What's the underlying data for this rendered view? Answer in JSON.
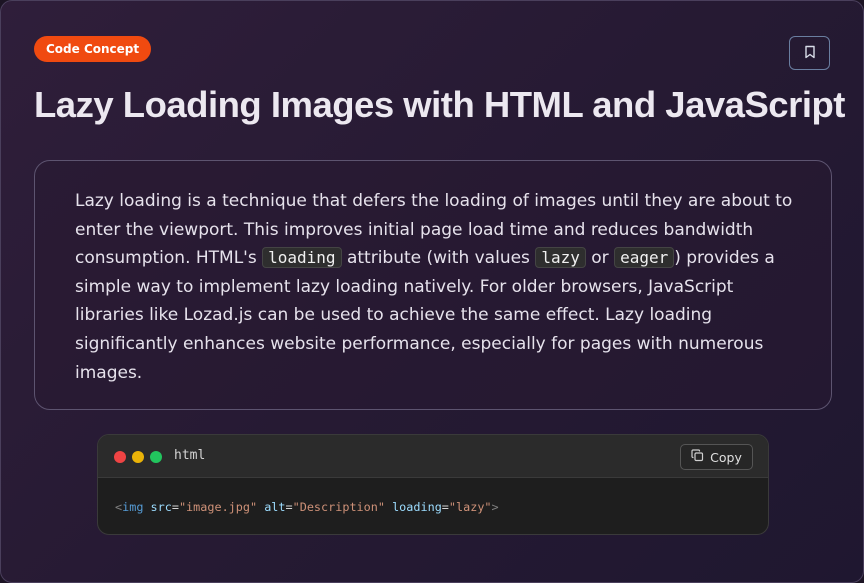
{
  "badge": {
    "label": "Code Concept",
    "color": "#f04a10"
  },
  "bookmark": {
    "icon": "bookmark-icon"
  },
  "title": "Lazy Loading Images with HTML and JavaScript",
  "description": {
    "part1": "Lazy loading is a technique that defers the loading of images until they are about to enter the viewport. This improves initial page load time and reduces bandwidth consumption. HTML's ",
    "code1": "loading",
    "part2": " attribute (with values ",
    "code2": "lazy",
    "part3": " or ",
    "code3": "eager",
    "part4": ") provides a simple way to implement lazy loading natively. For older browsers, JavaScript libraries like Lozad.js can be used to achieve the same effect. Lazy loading significantly enhances website performance, especially for pages with numerous images."
  },
  "code_block": {
    "language": "html",
    "copy_label": "Copy",
    "copy_icon": "copy-icon",
    "window_dots": [
      "#ef4444",
      "#eab308",
      "#22c55e"
    ],
    "code": {
      "open": "<",
      "tag": "img",
      "attr1": "src",
      "eq1": "=",
      "val1": "\"image.jpg\"",
      "attr2": "alt",
      "eq2": "=",
      "val2": "\"Description\"",
      "attr3": "loading",
      "eq3": "=",
      "val3": "\"lazy\"",
      "close": ">"
    }
  }
}
